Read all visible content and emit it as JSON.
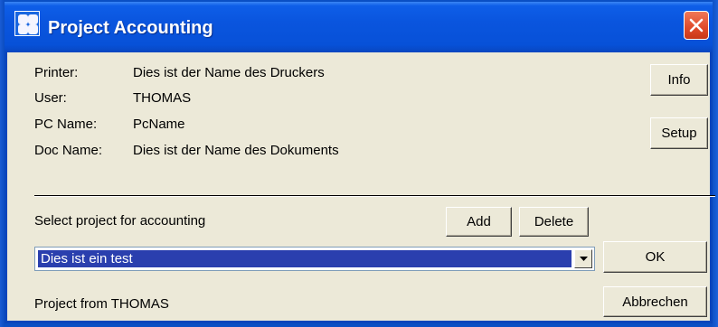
{
  "window": {
    "title": "Project Accounting"
  },
  "info_rows": [
    {
      "label": "Printer:",
      "value": "Dies ist der Name des Druckers"
    },
    {
      "label": "User:",
      "value": "THOMAS"
    },
    {
      "label": "PC Name:",
      "value": "PcName"
    },
    {
      "label": "Doc Name:",
      "value": "Dies ist der Name des Dokuments"
    }
  ],
  "buttons": {
    "info": "Info",
    "setup": "Setup",
    "add": "Add",
    "delete": "Delete",
    "ok": "OK",
    "cancel": "Abbrechen"
  },
  "select_label": "Select project for accounting",
  "project_select": {
    "value": "Dies ist ein test"
  },
  "project_from": "Project from THOMAS",
  "colors": {
    "titlebar": "#0a55de",
    "dialog_bg": "#ece9d8",
    "selection": "#2a3fae",
    "close": "#e04a2a"
  },
  "icons": {
    "app": "app-grid-icon",
    "close": "close-icon",
    "dropdown": "chevron-down-icon"
  }
}
